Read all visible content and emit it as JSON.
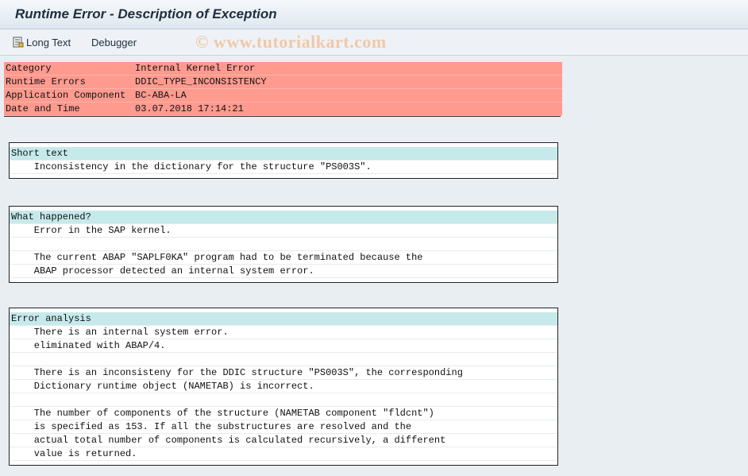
{
  "window": {
    "title": "Runtime Error - Description of Exception"
  },
  "toolbar": {
    "long_text_label": "Long Text",
    "debugger_label": "Debugger",
    "watermark": "© www.tutorialkart.com"
  },
  "header": [
    {
      "key": "Category",
      "value": "Internal Kernel Error"
    },
    {
      "key": "Runtime Errors",
      "value": "DDIC_TYPE_INCONSISTENCY"
    },
    {
      "key": "Application Component",
      "value": "BC-ABA-LA"
    },
    {
      "key": "Date and Time",
      "value": "03.07.2018 17:14:21"
    }
  ],
  "sections": [
    {
      "title": "Short text",
      "lines": [
        "    Inconsistency in the dictionary for the structure \"PS003S\"."
      ]
    },
    {
      "title": "What happened?",
      "lines": [
        "    Error in the SAP kernel.",
        "",
        "    The current ABAP \"SAPLF0KA\" program had to be terminated because the",
        "    ABAP processor detected an internal system error."
      ]
    },
    {
      "title": "Error analysis",
      "lines": [
        "    There is an internal system error.",
        "    eliminated with ABAP/4.",
        "",
        "    There is an inconsisteny for the DDIC structure \"PS003S\", the corresponding",
        "    Dictionary runtime object (NAMETAB) is incorrect.",
        "",
        "    The number of components of the structure (NAMETAB component \"fldcnt\")",
        "    is specified as 153. If all the substructures are resolved and the",
        "    actual total number of components is calculated recursively, a different",
        "    value is returned."
      ]
    }
  ]
}
